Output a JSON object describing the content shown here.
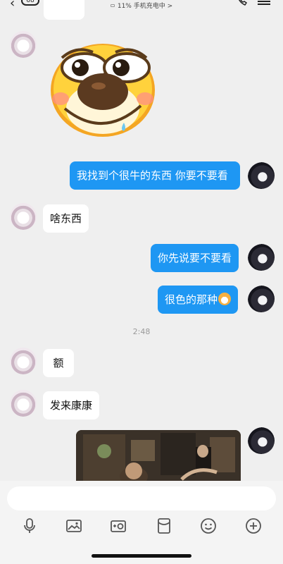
{
  "header": {
    "unread_count": "68",
    "status_text": "11% 手机充电中 >"
  },
  "messages": [
    {
      "side": "left",
      "type": "sticker"
    },
    {
      "side": "right",
      "type": "text",
      "text": "我找到个很牛的东西 你要不要看"
    },
    {
      "side": "left",
      "type": "text",
      "text": "啥东西"
    },
    {
      "side": "right",
      "type": "text",
      "text": "你先说要不要看"
    },
    {
      "side": "right",
      "type": "text",
      "text": "很色的那种"
    },
    {
      "side": "left",
      "type": "text",
      "text": "额"
    },
    {
      "side": "left",
      "type": "text",
      "text": "发来康康"
    },
    {
      "side": "right",
      "type": "image"
    }
  ],
  "timestamp": "2:48",
  "input": {
    "placeholder": ""
  },
  "toolbar": {
    "icons": [
      "microphone-icon",
      "image-icon",
      "camera-icon",
      "red-packet-icon",
      "emoji-icon",
      "plus-icon"
    ]
  },
  "colors": {
    "background": "#efefef",
    "outgoing_bubble": "#1e97f3",
    "incoming_bubble": "#ffffff"
  }
}
